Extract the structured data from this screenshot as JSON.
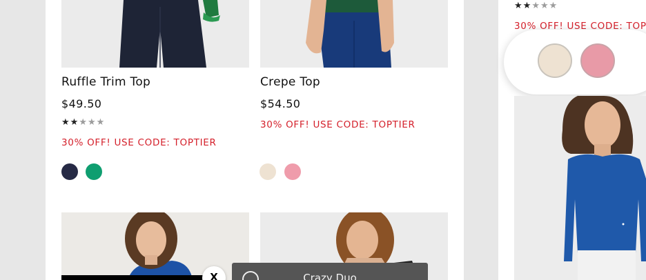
{
  "products": [
    {
      "name": "Ruffle Trim Top",
      "price": "$49.50",
      "rating": 2,
      "rating_max": 5,
      "promo": "30% OFF! USE CODE: TOPTIER",
      "swatches": [
        "#262a45",
        "#0f9e70"
      ]
    },
    {
      "name": "Crepe Top",
      "price": "$54.50",
      "promo": "30% OFF! USE CODE: TOPTIER",
      "swatches": [
        "#eee2d2",
        "#ef9cab"
      ]
    },
    {
      "rating": 2,
      "rating_max": 5,
      "promo": "30% OFF! USE CODE: TOPTIER",
      "swatches": [
        "#eee2d2",
        "#e89aa7"
      ]
    }
  ],
  "stars": {
    "filled": "★★",
    "empty": "★★★"
  },
  "close_label": "X",
  "toast": {
    "label": "Crazy Duo"
  }
}
